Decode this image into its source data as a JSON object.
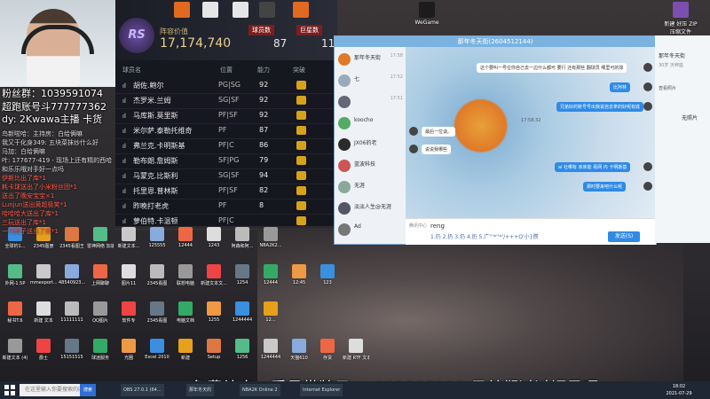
{
  "game": {
    "logo_text": "RS",
    "value_label": "阵容价值",
    "value": "17,174,740",
    "tag1": "球员数",
    "num1": "87",
    "tag2": "巨星数",
    "num2": "11",
    "columns": [
      "球员名",
      "位置",
      "能力",
      "突破"
    ],
    "players": [
      {
        "name": "胡佐.鲍尔",
        "pos": "PG|SG",
        "val": "92"
      },
      {
        "name": "杰罗米.兰姆",
        "pos": "SG|SF",
        "val": "92"
      },
      {
        "name": "马库斯.莫里斯",
        "pos": "PF|SF",
        "val": "92"
      },
      {
        "name": "米尔萨.泰勒托维奇",
        "pos": "PF",
        "val": "87"
      },
      {
        "name": "弗兰克.卡明斯基",
        "pos": "PF|C",
        "val": "86"
      },
      {
        "name": "勒布朗.詹姆斯",
        "pos": "SF|PG",
        "val": "79"
      },
      {
        "name": "马蒙克.比斯利",
        "pos": "SG|SF",
        "val": "94"
      },
      {
        "name": "托里恩.普林斯",
        "pos": "PF|SF",
        "val": "82"
      },
      {
        "name": "昨晚打老虎",
        "pos": "PF",
        "val": "8"
      },
      {
        "name": "萝伯特.卡温顿",
        "pos": "PF|C",
        "val": ""
      }
    ]
  },
  "overlay": {
    "fans_group": "粉丝群：1039591074",
    "line2": "超跑账号斗777777362",
    "line3": "dy: 2Kwawa主播 卡货",
    "chat": [
      {
        "text": "鸟新啦哈：主持房：白给俩嘛",
        "red": false
      },
      {
        "text": "我又干化身349: 五块菜抹炒什么好",
        "red": false
      },
      {
        "text": "马加：白给俩嘛",
        "red": false
      },
      {
        "text": "叶: 177677-419 - 现场上还有精的西哈",
        "red": false
      },
      {
        "text": "和乐乐哦对手好一点吗",
        "red": false
      },
      {
        "text": "伊斯比出了库*1",
        "red": true
      },
      {
        "text": "耗卡球送出了小米粉丝团*1",
        "red": true
      },
      {
        "text": "送出了晚安宝宝×1",
        "red": true
      },
      {
        "text": "Lunjun送出黄超极笑*1",
        "red": true
      },
      {
        "text": "哈哈哈大送出了库*1",
        "red": true
      },
      {
        "text": "三玩送出了库*1",
        "red": true
      },
      {
        "text": "一只鸽子送出了库*1",
        "red": true
      }
    ]
  },
  "desktop_top": [
    {
      "label": "",
      "color": "#e06a1f"
    },
    {
      "label": "",
      "color": "#e6e6e6"
    },
    {
      "label": "",
      "color": "#e6e6e6"
    },
    {
      "label": "",
      "color": "#444"
    },
    {
      "label": "",
      "color": "#e06a1f"
    },
    {
      "label": "WeGame",
      "color": "#1c1c1c"
    },
    {
      "label": "新建 好压\nZIP 压缩文件",
      "color": "#7a4fb0"
    }
  ],
  "qq": {
    "title": "那年冬天街(2604512144)",
    "contacts": [
      {
        "name": "那年冬天街",
        "time": "17:58"
      },
      {
        "name": "七",
        "time": "17:52"
      },
      {
        "name": "",
        "time": "17:51"
      },
      {
        "name": "koocho",
        "time": ""
      },
      {
        "name": "JX06的老",
        "time": ""
      },
      {
        "name": "蓝波科技",
        "time": ""
      },
      {
        "name": "无涯",
        "time": ""
      },
      {
        "name": "淡淡人生@无涯",
        "time": ""
      },
      {
        "name": "Ad",
        "time": ""
      }
    ],
    "msg_top": "这个要叫一号位你自己去一边什么都可 要行 还有那些 翻球员 哪里可的球",
    "msg_me1": "比阿林",
    "msg_me2": "兄弟好的账号号出我说自去拿的好呢有底",
    "msg_time": "17:58:32",
    "msg_them1": "最后一位谈。",
    "msg_them2": "说说我哪些",
    "msg_me3": "ai 社哪有 库库能 看网 内 卡明斯基",
    "msg_me4": "那时要来吧什么呢",
    "input_prefix": "腾讯中心",
    "input_text": "reng",
    "candidates": "1.仍 2.扔 3.仍 4.扔 5.广'''*''*'/+++O'小}攒",
    "send_label": "发送(S)"
  },
  "rpanel": {
    "title": "那年冬天街",
    "sub": "30岁 天秤座",
    "label": "查看照片",
    "photo": "无照片"
  },
  "desktop_grid": [
    [
      "全球钓1...",
      "2345图册",
      "2345看图王",
      "雷神网络\n加速器",
      "新建文本...",
      "125555",
      "12444",
      "1243",
      "阿森和阿...",
      "NBA2K2..."
    ],
    [
      "外网-1.5P",
      "mmexport...",
      "48540923...",
      "上网聊聊",
      "图片11",
      "2345看图",
      "联想电脑",
      "新建文本文...",
      "1254",
      "12444",
      "12:45",
      "123"
    ],
    [
      "秘书T.6",
      "新建 文本",
      "11111111",
      "QQ图片",
      "软件专",
      "2345看图",
      "电脑文档",
      "1255",
      "1244444",
      "12..."
    ],
    [
      "新建文本 (4)",
      "爵士",
      "15151515",
      "球迷服务",
      "光圈",
      "Excel 2010",
      "新建",
      "Setup",
      "1256",
      "1244444",
      "天猫610",
      "存货",
      "新建 RTF 文本"
    ]
  ],
  "subtitle": "免费补卡，看号带牌子+q893335213 兄弟们过过福星呀",
  "taskbar": {
    "search_placeholder": "在这里输入你要搜索的内容",
    "search_btn": "搜索",
    "apps": [
      "OBS 27.0.1 (64...",
      "那年冬天的",
      "NBA2K Online 2",
      "Internet Explorer"
    ],
    "time": "18:02",
    "date": "2021-07-29"
  }
}
